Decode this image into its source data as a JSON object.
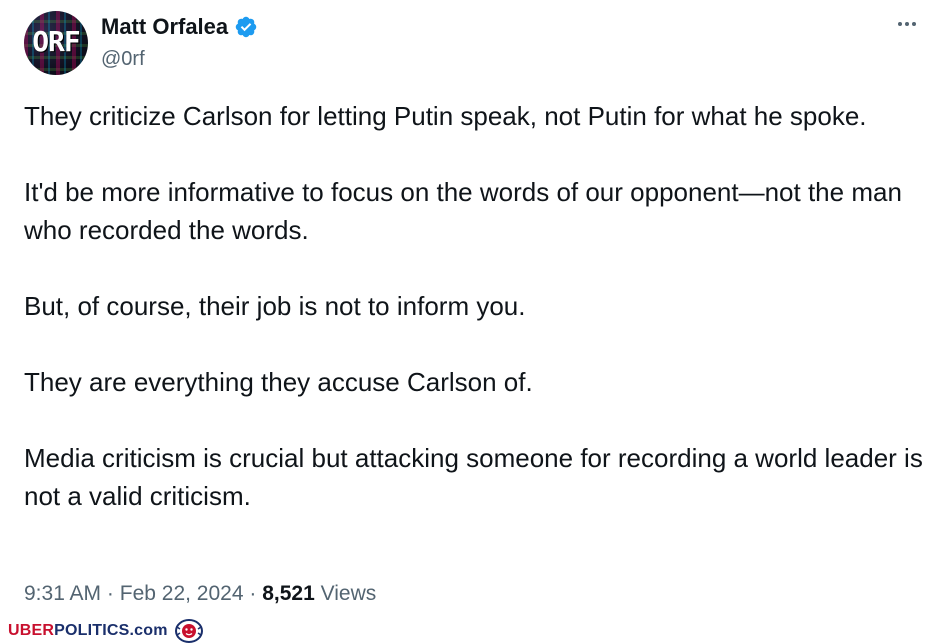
{
  "author": {
    "display_name": "Matt Orfalea",
    "handle": "@0rf",
    "avatar_label": "ORF",
    "verified_color": "#1d9bf0"
  },
  "tweet": {
    "paragraphs": [
      "They criticize Carlson for letting Putin speak, not Putin for what he spoke.",
      "It'd be more informative to focus on the words of our opponent—not the man who recorded the words.",
      "But, of course, their job is not to inform you.",
      "They are everything they accuse Carlson of.",
      "Media criticism is crucial but attacking someone for recording a world leader is not a valid criticism."
    ],
    "time": "9:31 AM",
    "separator": "·",
    "date": "Feb 22, 2024",
    "views_count": "8,521",
    "views_label": "Views"
  },
  "watermark": {
    "part1": "UBER",
    "part2": "POLITICS",
    "part3": ".com"
  },
  "icons": {
    "more": "more-options-icon",
    "verified": "verified-badge-icon",
    "watermark_logo": "lion-crest-icon"
  },
  "colors": {
    "text_primary": "#0f1419",
    "text_secondary": "#536471",
    "verified_blue": "#1d9bf0",
    "watermark_red": "#c8102e",
    "watermark_navy": "#1a2f6b"
  }
}
